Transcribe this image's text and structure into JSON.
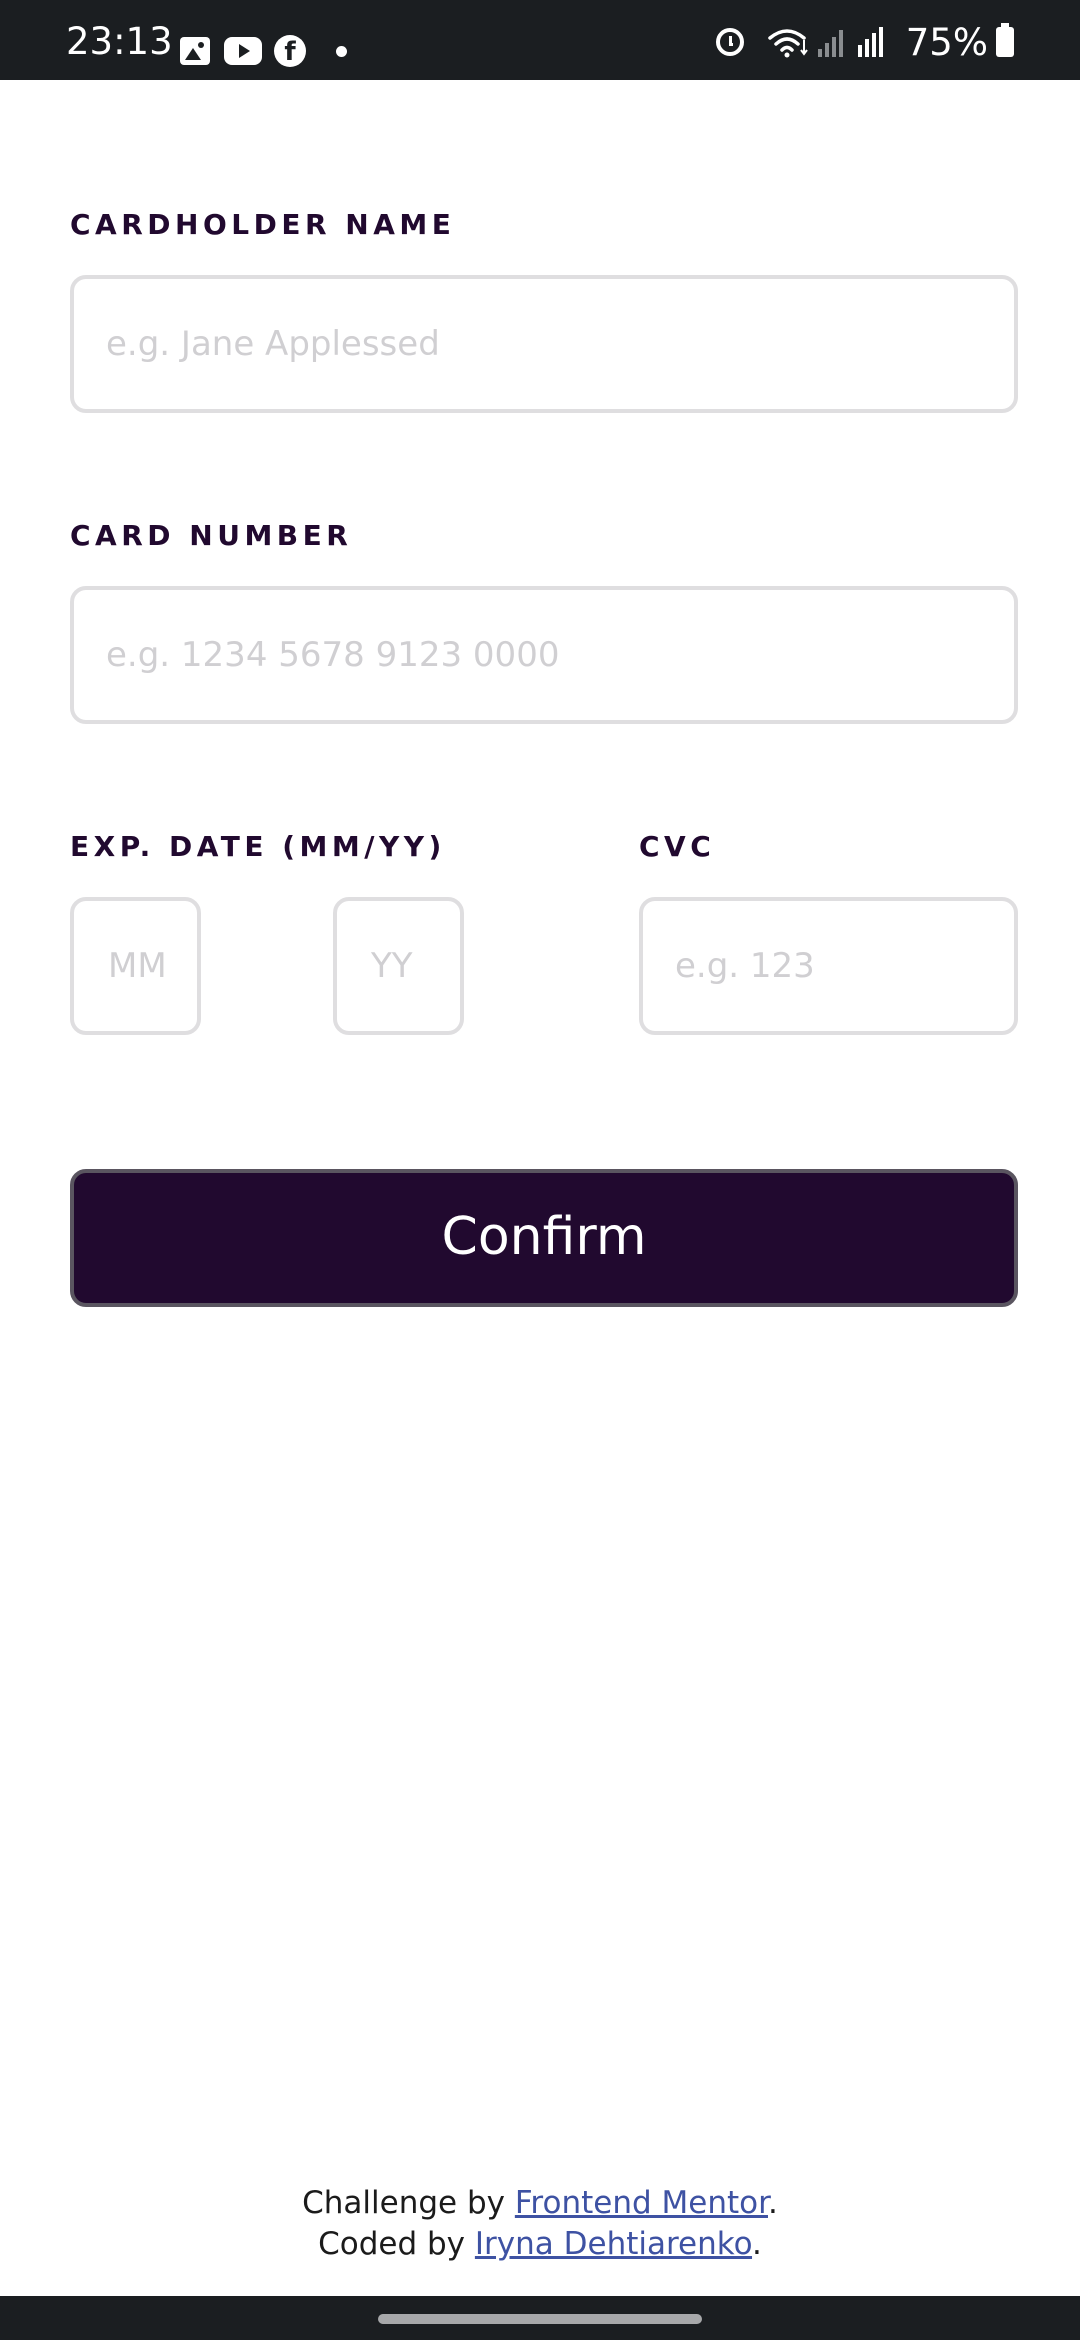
{
  "status_bar": {
    "time": "23:13",
    "battery": "75%",
    "left_icons": [
      "gallery-icon",
      "youtube-icon",
      "facebook-icon",
      "dot-icon"
    ],
    "right_icons": [
      "alarm-icon",
      "wifi-icon",
      "signal-icon",
      "signal-icon",
      "battery-icon"
    ]
  },
  "form": {
    "cardholder": {
      "label": "CARDHOLDER NAME",
      "placeholder": "e.g. Jane Applessed",
      "value": ""
    },
    "card_number": {
      "label": "CARD NUMBER",
      "placeholder": "e.g. 1234 5678 9123 0000",
      "value": ""
    },
    "exp_date": {
      "label": "EXP. DATE (MM/YY)",
      "month_placeholder": "MM",
      "year_placeholder": "YY"
    },
    "cvc": {
      "label": "CVC",
      "placeholder": "e.g. 123",
      "value": ""
    },
    "confirm_label": "Confirm"
  },
  "footer": {
    "challenge_prefix": "Challenge by ",
    "challenge_link": "Frontend Mentor",
    "challenge_suffix": ".",
    "coded_prefix": "Coded by ",
    "coded_link": "Iryna Dehtiarenko",
    "coded_suffix": "."
  },
  "colors": {
    "accent": "#21092f",
    "input_border": "#dfdee0",
    "placeholder": "#d0cfd2",
    "link": "#3e52a3",
    "system_bar": "#1b1e21"
  }
}
